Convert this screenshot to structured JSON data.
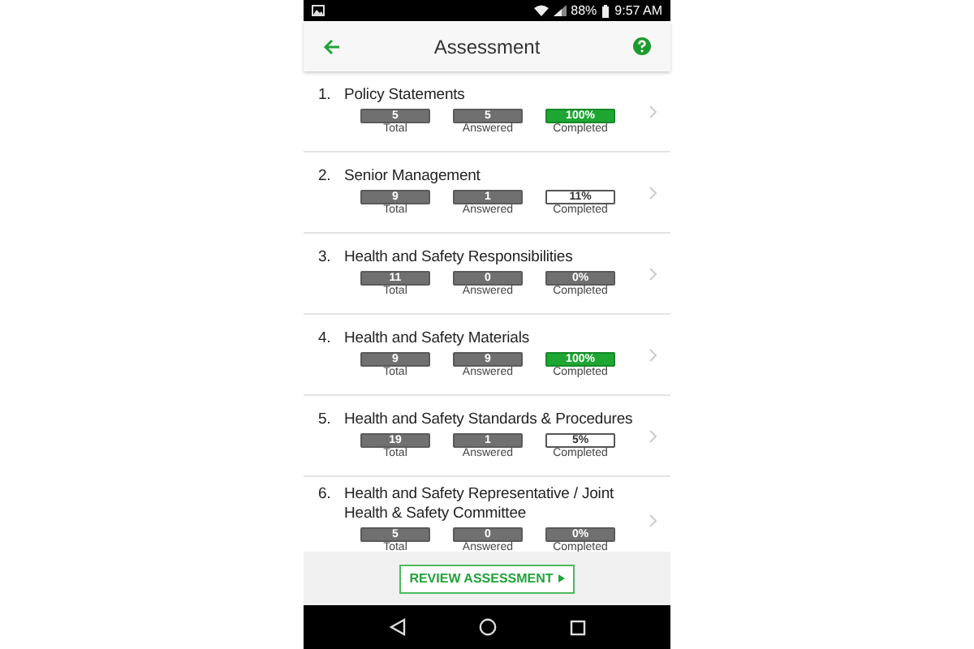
{
  "status_bar": {
    "battery": "88%",
    "time": "9:57 AM"
  },
  "header": {
    "title": "Assessment"
  },
  "sections": [
    {
      "number": "1.",
      "title": "Policy Statements",
      "stats": [
        {
          "kind": "count",
          "value": "5",
          "label": "Total"
        },
        {
          "kind": "count",
          "value": "5",
          "label": "Answered"
        },
        {
          "kind": "complete",
          "value": "100%",
          "label": "Completed"
        }
      ]
    },
    {
      "number": "2.",
      "title": "Senior Management",
      "stats": [
        {
          "kind": "count",
          "value": "9",
          "label": "Total"
        },
        {
          "kind": "count",
          "value": "1",
          "label": "Answered"
        },
        {
          "kind": "partial",
          "value": "11%",
          "label": "Completed"
        }
      ]
    },
    {
      "number": "3.",
      "title": "Health and Safety Responsibilities",
      "stats": [
        {
          "kind": "count",
          "value": "11",
          "label": "Total"
        },
        {
          "kind": "count",
          "value": "0",
          "label": "Answered"
        },
        {
          "kind": "empty",
          "value": "0%",
          "label": "Completed"
        }
      ]
    },
    {
      "number": "4.",
      "title": "Health and Safety Materials",
      "stats": [
        {
          "kind": "count",
          "value": "9",
          "label": "Total"
        },
        {
          "kind": "count",
          "value": "9",
          "label": "Answered"
        },
        {
          "kind": "complete",
          "value": "100%",
          "label": "Completed"
        }
      ]
    },
    {
      "number": "5.",
      "title": "Health and Safety Standards & Procedures",
      "stats": [
        {
          "kind": "count",
          "value": "19",
          "label": "Total"
        },
        {
          "kind": "count",
          "value": "1",
          "label": "Answered"
        },
        {
          "kind": "partial",
          "value": "5%",
          "label": "Completed"
        }
      ]
    },
    {
      "number": "6.",
      "title": "Health and Safety Representative / Joint Health & Safety Committee",
      "stats": [
        {
          "kind": "count",
          "value": "5",
          "label": "Total"
        },
        {
          "kind": "count",
          "value": "0",
          "label": "Answered"
        },
        {
          "kind": "empty",
          "value": "0%",
          "label": "Completed"
        }
      ]
    }
  ],
  "footer": {
    "button": "REVIEW ASSESSMENT"
  }
}
